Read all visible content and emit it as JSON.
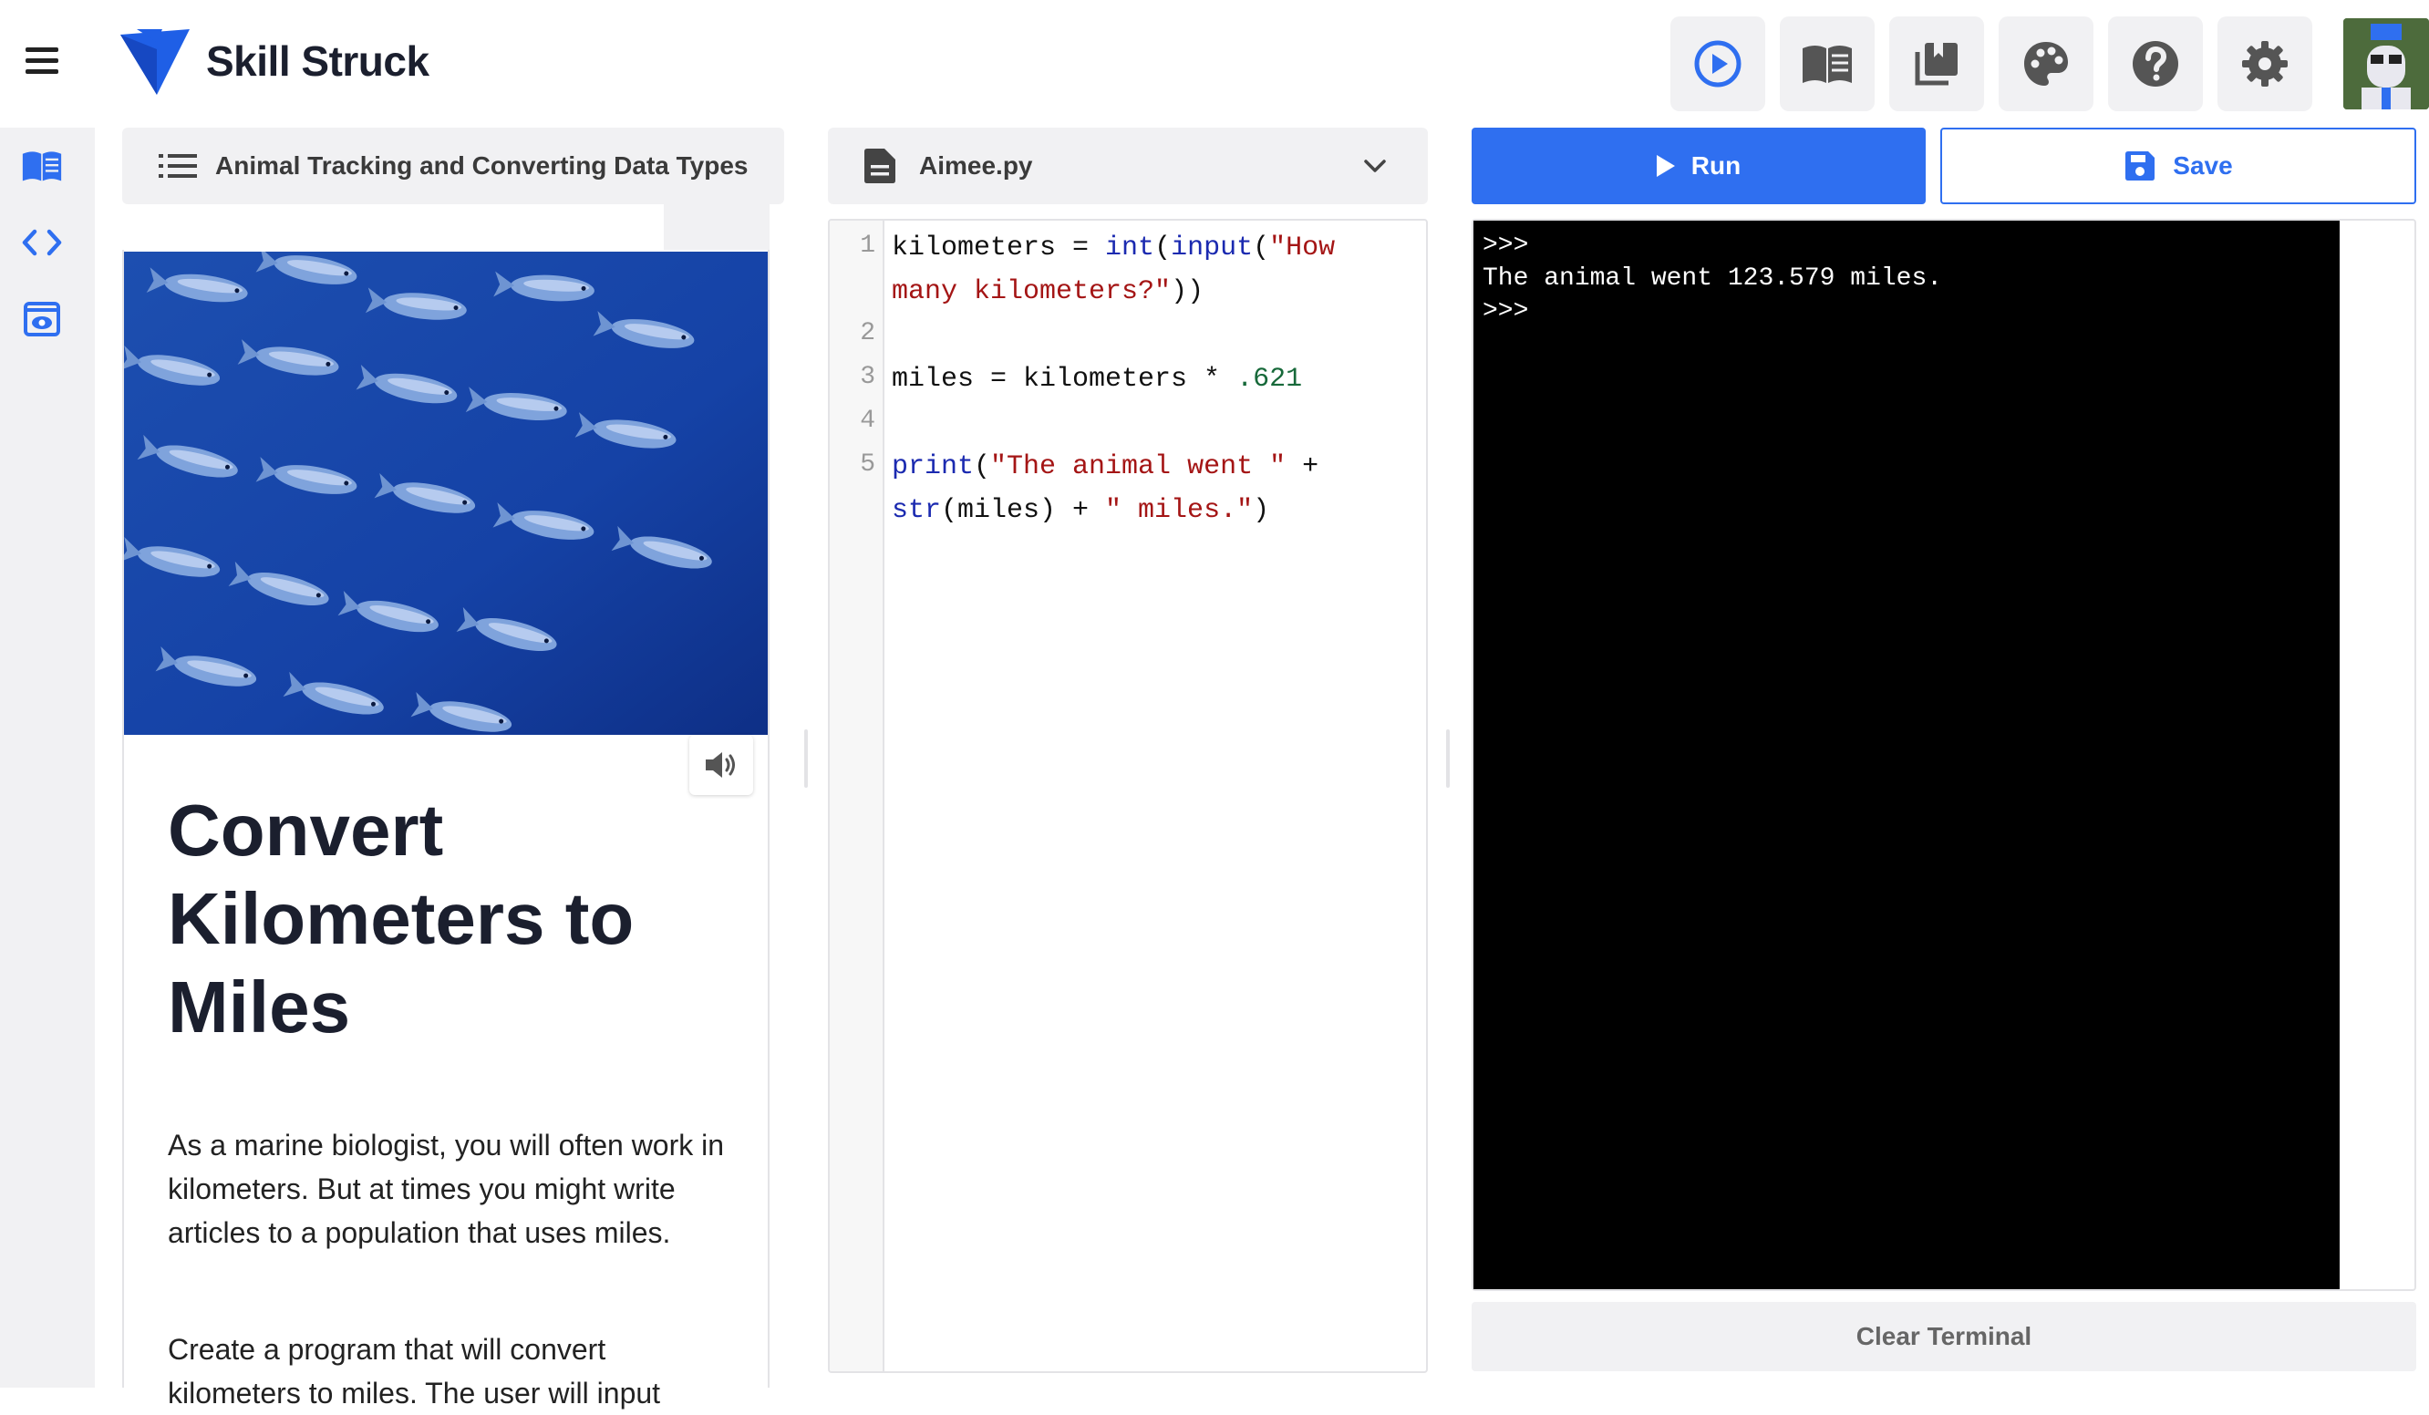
{
  "brand": {
    "name": "Skill Struck"
  },
  "toolbar": {
    "icons": [
      "play-circle-icon",
      "open-book-icon",
      "library-icon",
      "palette-icon",
      "help-icon",
      "settings-icon"
    ]
  },
  "sidebar": {
    "icons": [
      "open-book-icon",
      "code-icon",
      "preview-icon"
    ]
  },
  "lesson": {
    "breadcrumb": "Animal Tracking and Converting Data Types",
    "heading": "Convert Kilometers to Miles",
    "paragraphs": [
      "As a marine biologist, you will often work in kilometers. But at times you might write articles to a population that uses miles.",
      "Create a program that will convert kilometers to miles. The user will input"
    ]
  },
  "editor": {
    "file_name": "Aimee.py",
    "line_numbers": [
      "1",
      "2",
      "3",
      "4",
      "5"
    ],
    "lines": {
      "l1_var": "kilometers",
      "l1_op": " = ",
      "l1_fn1": "int",
      "l1_p1": "(",
      "l1_fn2": "input",
      "l1_p2": "(",
      "l1_str_a": "\"How",
      "l1_str_b": "many kilometers?\"",
      "l1_close": "))",
      "l3": "miles = kilometers * ",
      "l3_num": ".621",
      "l5_fn": "print",
      "l5_p": "(",
      "l5_str": "\"The animal went \"",
      "l5_plus": " +",
      "l5b_fn": "str",
      "l5b_mid": "(miles) + ",
      "l5b_str": "\" miles.\"",
      "l5b_close": ")"
    }
  },
  "actions": {
    "run_label": "Run",
    "save_label": "Save",
    "clear_label": "Clear Terminal"
  },
  "console": {
    "output": ">>>\nThe animal went 123.579 miles.\n>>>"
  },
  "colors": {
    "accent": "#2f6ff0",
    "logo": "#1f5fe6",
    "terminal_bg": "#000000",
    "keyword": "#1b2ab0",
    "string": "#a41515",
    "number": "#17693a"
  }
}
